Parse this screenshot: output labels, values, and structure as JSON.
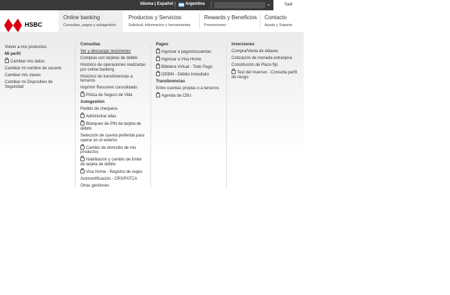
{
  "topbar": {
    "language": "Idioma ( Español )",
    "country": "Argentina",
    "logout": "Salir"
  },
  "brand": {
    "name": "HSBC"
  },
  "nav": [
    {
      "title": "Online banking",
      "subtitle": "Consultas, pagos y autogestión"
    },
    {
      "title": "Productos y Servicios",
      "subtitle": "Solicitud, información y herramientas"
    },
    {
      "title": "Rewards y Beneficios",
      "subtitle": "Promociones"
    },
    {
      "title": "Contacto",
      "subtitle": "Ayuda y Soporte"
    }
  ],
  "col1": {
    "back": "Volver a mis productos",
    "header": "Mi perfil",
    "items": [
      "Cambiar mis datos",
      "Cambiar mi nombre de usuario",
      "Cambiar mis claves",
      "Cambiar mi Dispositivo de Seguridad"
    ]
  },
  "col2": {
    "header1": "Consultas",
    "items1": [
      "Ver y descargar resúmenes",
      "Compras con tarjetas de débito",
      "Histórico de operaciones realizadas por online banking",
      "Histórico de transferencias a terceros",
      "Imprimir Resumen consolidado",
      "Póliza de Seguro de Vida"
    ],
    "header2": "Autogestión",
    "items2": [
      "Pedido de chequera",
      "Administrar alias",
      "Blanqueo de PIN de tarjeta de débito",
      "Selección de cuenta preferida para operar en el exterior",
      "Cambio de domicilio de mis productos",
      "Habilitación y cambio de límite de tarjeta de débito",
      "Visa Home - Registro de viajes",
      "Autocertificación - CRS/FATCA",
      "Otras gestiones"
    ]
  },
  "col3": {
    "header1": "Pagos",
    "items1": [
      "Ingresar a pagomiscuentas",
      "Ingresar a Visa Home",
      "Billetera Virtual - Todo Pago",
      "DEBIN - Débito Inmediato"
    ],
    "header2": "Transferencias",
    "items2": [
      "Entre cuentas propias o a terceros",
      "Agenda de CBU"
    ]
  },
  "col4": {
    "header": "Inversiones",
    "items": [
      "Compra/Venta de dólares",
      "Cotización de moneda extranjera",
      "Constitución de Plazo fijo",
      "Test del inversor - Consulta perfil de riesgo"
    ]
  }
}
